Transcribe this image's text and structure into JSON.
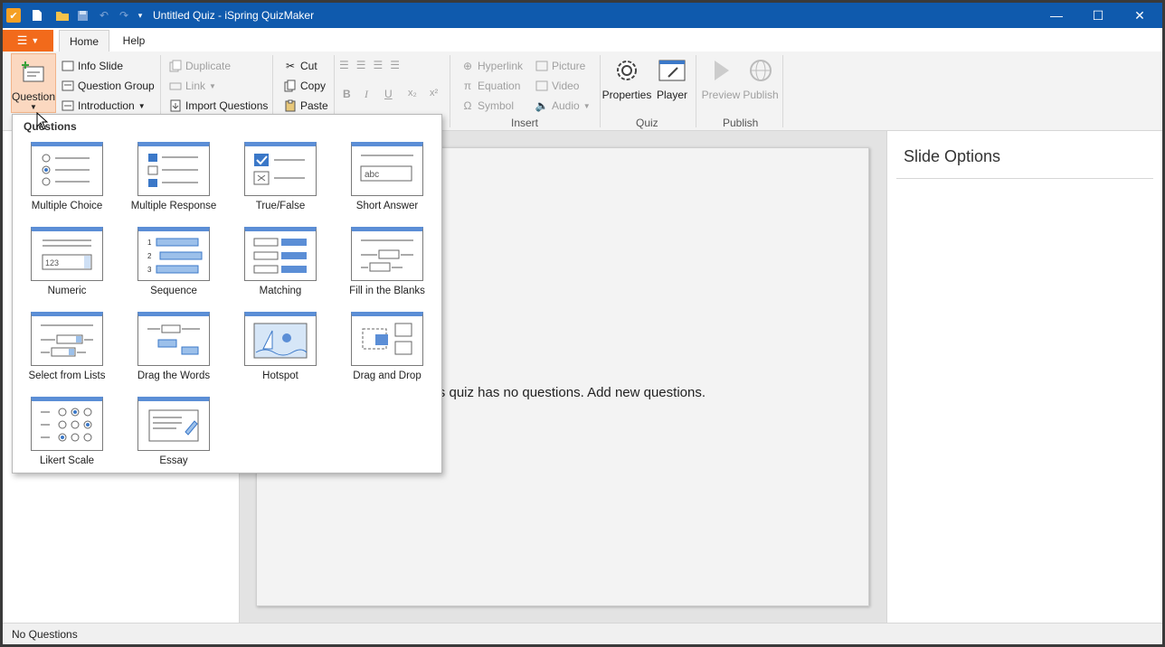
{
  "window": {
    "title": "Untitled Quiz - iSpring QuizMaker",
    "controls": {
      "minimize": "—",
      "maximize": "☐",
      "close": "✕"
    }
  },
  "tabs": [
    {
      "label": "Home",
      "active": true
    },
    {
      "label": "Help",
      "active": false
    }
  ],
  "ribbon": {
    "question_button": "Question",
    "slides": {
      "info_slide": "Info Slide",
      "question_group": "Question Group",
      "introduction": "Introduction"
    },
    "edit": {
      "duplicate": "Duplicate",
      "link": "Link",
      "import_questions": "Import Questions"
    },
    "clipboard": {
      "cut": "Cut",
      "copy": "Copy",
      "paste": "Paste"
    },
    "insert": {
      "hyperlink": "Hyperlink",
      "equation": "Equation",
      "symbol": "Symbol",
      "picture": "Picture",
      "video": "Video",
      "audio": "Audio",
      "group_label": "Insert"
    },
    "quiz": {
      "properties": "Properties",
      "player": "Player",
      "group_label": "Quiz"
    },
    "publish": {
      "preview": "Preview",
      "publish": "Publish",
      "group_label": "Publish"
    }
  },
  "dropdown": {
    "title": "Questions",
    "items": [
      {
        "label": "Multiple Choice",
        "icon": "multiple-choice-icon"
      },
      {
        "label": "Multiple Response",
        "icon": "multiple-response-icon"
      },
      {
        "label": "True/False",
        "icon": "true-false-icon"
      },
      {
        "label": "Short Answer",
        "icon": "short-answer-icon"
      },
      {
        "label": "Numeric",
        "icon": "numeric-icon"
      },
      {
        "label": "Sequence",
        "icon": "sequence-icon"
      },
      {
        "label": "Matching",
        "icon": "matching-icon"
      },
      {
        "label": "Fill in the Blanks",
        "icon": "fill-in-blanks-icon"
      },
      {
        "label": "Select from Lists",
        "icon": "select-from-lists-icon"
      },
      {
        "label": "Drag the Words",
        "icon": "drag-the-words-icon"
      },
      {
        "label": "Hotspot",
        "icon": "hotspot-icon"
      },
      {
        "label": "Drag and Drop",
        "icon": "drag-and-drop-icon"
      },
      {
        "label": "Likert Scale",
        "icon": "likert-scale-icon"
      },
      {
        "label": "Essay",
        "icon": "essay-icon"
      }
    ],
    "thumb_texts": {
      "short_answer": "abc",
      "numeric": "123",
      "seq_1": "1",
      "seq_2": "2",
      "seq_3": "3"
    }
  },
  "main": {
    "empty_message": "This quiz has no questions. Add new questions."
  },
  "right_panel": {
    "title": "Slide Options"
  },
  "status": {
    "text": "No Questions"
  },
  "colors": {
    "titlebar": "#0f5aad",
    "file_button": "#f26a1b",
    "accent_blue": "#5b8ed6"
  }
}
